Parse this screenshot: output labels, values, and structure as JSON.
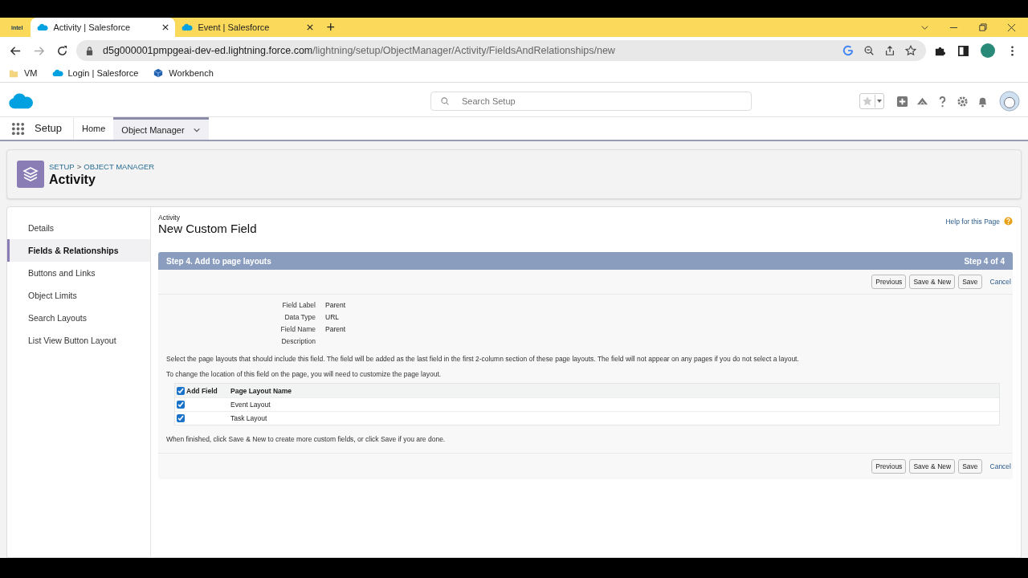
{
  "browser": {
    "profile_badge": "intel",
    "tabs": [
      {
        "title": "Activity | Salesforce",
        "selected": true
      },
      {
        "title": "Event | Salesforce",
        "selected": false
      }
    ],
    "new_tab": "+",
    "url_host": "d5g000001pmpgeai-dev-ed.lightning.force.com",
    "url_path": "/lightning/setup/ObjectManager/Activity/FieldsAndRelationships/new",
    "bookmarks": [
      {
        "label": "VM",
        "kind": "folder"
      },
      {
        "label": "Login | Salesforce",
        "kind": "cloud"
      },
      {
        "label": "Workbench",
        "kind": "cube"
      }
    ]
  },
  "header": {
    "search": {
      "placeholder": "Search Setup"
    }
  },
  "nav": {
    "app": "Setup",
    "items": [
      {
        "label": "Home",
        "selected": false
      },
      {
        "label": "Object Manager",
        "selected": true
      }
    ]
  },
  "object_header": {
    "breadcrumb": [
      "SETUP",
      "OBJECT MANAGER"
    ],
    "separator": ">",
    "title": "Activity"
  },
  "sidebar": {
    "items": [
      {
        "label": "Details",
        "selected": false
      },
      {
        "label": "Fields & Relationships",
        "selected": true
      },
      {
        "label": "Buttons and Links",
        "selected": false
      },
      {
        "label": "Object Limits",
        "selected": false
      },
      {
        "label": "Search Layouts",
        "selected": false
      },
      {
        "label": "List View Button Layout",
        "selected": false
      }
    ]
  },
  "page": {
    "object": "Activity",
    "title": "New Custom Field",
    "help": "Help for this Page",
    "step_title": "Step 4. Add to page layouts",
    "step_count": "Step 4 of 4",
    "buttons": [
      "Previous",
      "Save & New",
      "Save"
    ],
    "cancel": "Cancel",
    "details": [
      {
        "label": "Field Label",
        "value": "Parent"
      },
      {
        "label": "Data Type",
        "value": "URL"
      },
      {
        "label": "Field Name",
        "value": "Parent"
      },
      {
        "label": "Description"
      }
    ],
    "instructions": [
      "Select the page layouts that should include this field. The field will be added as the last field in the first 2-column section of these page layouts. The field will not appear on any pages if you do not select a layout.",
      "To change the location of this field on the page, you will need to customize the page layout."
    ],
    "layouts_table": {
      "add_column": "Add Field",
      "all_checked": true,
      "name_column": "Page Layout Name",
      "rows": [
        {
          "name": "Event Layout",
          "checked": true
        },
        {
          "name": "Task Layout",
          "checked": true
        }
      ]
    },
    "footer_note": "When finished, click Save & New to create more custom fields, or click Save if you are done.",
    "bottom_buttons": [
      "Previous",
      "Save & New",
      "Save"
    ],
    "bottom_cancel": "Cancel"
  }
}
